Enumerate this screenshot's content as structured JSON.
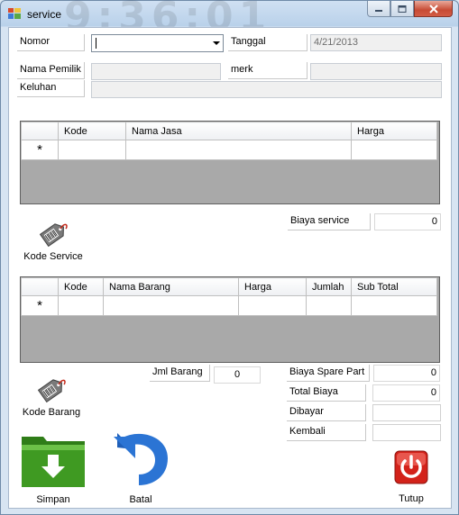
{
  "window": {
    "title": "service",
    "ghost_clock": "9:36:01"
  },
  "form": {
    "nomor_label": "Nomor",
    "nomor_value": "",
    "tanggal_label": "Tanggal",
    "tanggal_value": "4/21/2013",
    "nama_pemilik_label": "Nama Pemilik",
    "nama_pemilik_value": "",
    "merk_label": "merk",
    "merk_value": "",
    "keluhan_label": "Keluhan",
    "keluhan_value": ""
  },
  "jasa_grid": {
    "columns": [
      "Kode",
      "Nama Jasa",
      "Harga"
    ],
    "new_row_marker": "*"
  },
  "biaya_service": {
    "label": "Biaya service",
    "value": "0"
  },
  "kode_service": {
    "label": "Kode Service",
    "icon": "barcode-tag-icon"
  },
  "barang_grid": {
    "columns": [
      "Kode",
      "Nama Barang",
      "Harga",
      "Jumlah",
      "Sub Total"
    ],
    "new_row_marker": "*"
  },
  "jml_barang": {
    "label": "Jml Barang",
    "value": "0"
  },
  "totals": {
    "spare_part_label": "Biaya Spare Part",
    "spare_part_value": "0",
    "total_biaya_label": "Total Biaya",
    "total_biaya_value": "0",
    "dibayar_label": "Dibayar",
    "dibayar_value": "",
    "kembali_label": "Kembali",
    "kembali_value": ""
  },
  "kode_barang": {
    "label": "Kode Barang",
    "icon": "barcode-tag-icon"
  },
  "actions": {
    "simpan": {
      "label": "Simpan",
      "icon": "green-folder-save-icon"
    },
    "batal": {
      "label": "Batal",
      "icon": "blue-undo-arrow-icon"
    },
    "tutup": {
      "label": "Tutup",
      "icon": "red-power-icon"
    }
  },
  "colors": {
    "grid_bg": "#a9a9a9",
    "close_btn": "#c74b34"
  }
}
